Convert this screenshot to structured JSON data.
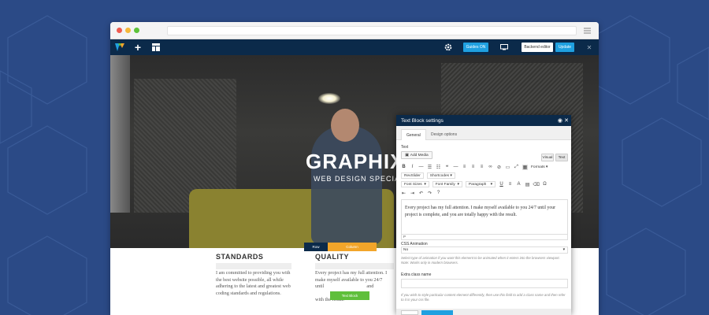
{
  "toolbar": {
    "guides_label": "Guides ON",
    "backend_label": "Backend editor",
    "update_label": "Update",
    "close_glyph": "✕",
    "add_glyph": "+",
    "accent": "#1fa0e0"
  },
  "hero": {
    "title": "GRAPHIX",
    "subtitle": "WEB DESIGN SPECIALIST"
  },
  "columns": [
    {
      "title": "STANDARDS",
      "text": "I am committed to providing you with the best website possible, all while adhering to the latest and greatest web coding standards and regulations."
    },
    {
      "title": "QUALITY",
      "text_lines": [
        "Every project has my full attention. I",
        "make myself available to you 24/7",
        "until",
        "and",
        "with the result."
      ]
    }
  ],
  "element_controls": {
    "row_label": "Row",
    "column_label": "Column",
    "text_block_label": "Text Block"
  },
  "modal": {
    "title": "Text Block settings",
    "tabs": [
      "General",
      "Design options"
    ],
    "text_label": "Text",
    "add_media_label": "Add Media",
    "visual_tab": "Visual",
    "text_tab": "Text",
    "formats_label": "Formats",
    "revslider_label": "RevSlider",
    "shortcodes_label": "Shortcodes",
    "font_sizes_label": "Font Sizes",
    "font_family_label": "Font Family",
    "paragraph_label": "Paragraph",
    "editor_content": "Every project has my full attention. I make myself available to you 24/7 until your project is complete, and you are totally happy with the result.",
    "path_label": "P",
    "css_animation_label": "CSS Animation",
    "css_animation_value": "No",
    "css_animation_help": "Select type of animation if you want this element to be animated when it enters into the browsers viewport. Note: Works only in modern browsers.",
    "extra_class_label": "Extra class name",
    "extra_class_value": "",
    "extra_class_help": "If you wish to style particular content element differently, then use this field to add a class name and then refer to it in your css file."
  }
}
